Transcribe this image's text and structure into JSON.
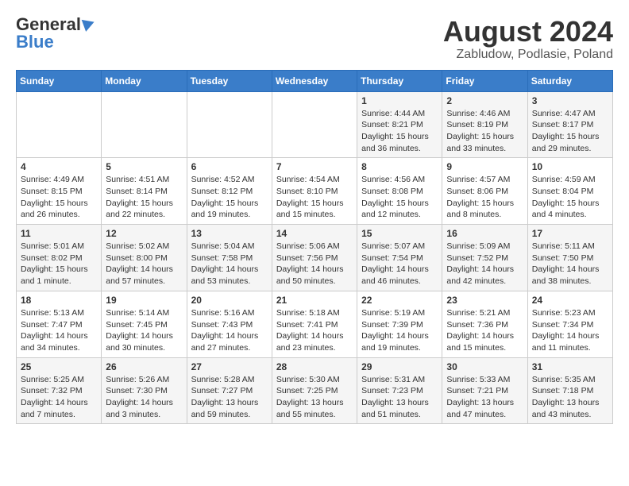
{
  "header": {
    "logo_top": "General",
    "logo_bottom": "Blue",
    "title": "August 2024",
    "subtitle": "Zabludow, Podlasie, Poland"
  },
  "calendar": {
    "days_of_week": [
      "Sunday",
      "Monday",
      "Tuesday",
      "Wednesday",
      "Thursday",
      "Friday",
      "Saturday"
    ],
    "weeks": [
      [
        {
          "day": "",
          "info": ""
        },
        {
          "day": "",
          "info": ""
        },
        {
          "day": "",
          "info": ""
        },
        {
          "day": "",
          "info": ""
        },
        {
          "day": "1",
          "info": "Sunrise: 4:44 AM\nSunset: 8:21 PM\nDaylight: 15 hours\nand 36 minutes."
        },
        {
          "day": "2",
          "info": "Sunrise: 4:46 AM\nSunset: 8:19 PM\nDaylight: 15 hours\nand 33 minutes."
        },
        {
          "day": "3",
          "info": "Sunrise: 4:47 AM\nSunset: 8:17 PM\nDaylight: 15 hours\nand 29 minutes."
        }
      ],
      [
        {
          "day": "4",
          "info": "Sunrise: 4:49 AM\nSunset: 8:15 PM\nDaylight: 15 hours\nand 26 minutes."
        },
        {
          "day": "5",
          "info": "Sunrise: 4:51 AM\nSunset: 8:14 PM\nDaylight: 15 hours\nand 22 minutes."
        },
        {
          "day": "6",
          "info": "Sunrise: 4:52 AM\nSunset: 8:12 PM\nDaylight: 15 hours\nand 19 minutes."
        },
        {
          "day": "7",
          "info": "Sunrise: 4:54 AM\nSunset: 8:10 PM\nDaylight: 15 hours\nand 15 minutes."
        },
        {
          "day": "8",
          "info": "Sunrise: 4:56 AM\nSunset: 8:08 PM\nDaylight: 15 hours\nand 12 minutes."
        },
        {
          "day": "9",
          "info": "Sunrise: 4:57 AM\nSunset: 8:06 PM\nDaylight: 15 hours\nand 8 minutes."
        },
        {
          "day": "10",
          "info": "Sunrise: 4:59 AM\nSunset: 8:04 PM\nDaylight: 15 hours\nand 4 minutes."
        }
      ],
      [
        {
          "day": "11",
          "info": "Sunrise: 5:01 AM\nSunset: 8:02 PM\nDaylight: 15 hours\nand 1 minute."
        },
        {
          "day": "12",
          "info": "Sunrise: 5:02 AM\nSunset: 8:00 PM\nDaylight: 14 hours\nand 57 minutes."
        },
        {
          "day": "13",
          "info": "Sunrise: 5:04 AM\nSunset: 7:58 PM\nDaylight: 14 hours\nand 53 minutes."
        },
        {
          "day": "14",
          "info": "Sunrise: 5:06 AM\nSunset: 7:56 PM\nDaylight: 14 hours\nand 50 minutes."
        },
        {
          "day": "15",
          "info": "Sunrise: 5:07 AM\nSunset: 7:54 PM\nDaylight: 14 hours\nand 46 minutes."
        },
        {
          "day": "16",
          "info": "Sunrise: 5:09 AM\nSunset: 7:52 PM\nDaylight: 14 hours\nand 42 minutes."
        },
        {
          "day": "17",
          "info": "Sunrise: 5:11 AM\nSunset: 7:50 PM\nDaylight: 14 hours\nand 38 minutes."
        }
      ],
      [
        {
          "day": "18",
          "info": "Sunrise: 5:13 AM\nSunset: 7:47 PM\nDaylight: 14 hours\nand 34 minutes."
        },
        {
          "day": "19",
          "info": "Sunrise: 5:14 AM\nSunset: 7:45 PM\nDaylight: 14 hours\nand 30 minutes."
        },
        {
          "day": "20",
          "info": "Sunrise: 5:16 AM\nSunset: 7:43 PM\nDaylight: 14 hours\nand 27 minutes."
        },
        {
          "day": "21",
          "info": "Sunrise: 5:18 AM\nSunset: 7:41 PM\nDaylight: 14 hours\nand 23 minutes."
        },
        {
          "day": "22",
          "info": "Sunrise: 5:19 AM\nSunset: 7:39 PM\nDaylight: 14 hours\nand 19 minutes."
        },
        {
          "day": "23",
          "info": "Sunrise: 5:21 AM\nSunset: 7:36 PM\nDaylight: 14 hours\nand 15 minutes."
        },
        {
          "day": "24",
          "info": "Sunrise: 5:23 AM\nSunset: 7:34 PM\nDaylight: 14 hours\nand 11 minutes."
        }
      ],
      [
        {
          "day": "25",
          "info": "Sunrise: 5:25 AM\nSunset: 7:32 PM\nDaylight: 14 hours\nand 7 minutes."
        },
        {
          "day": "26",
          "info": "Sunrise: 5:26 AM\nSunset: 7:30 PM\nDaylight: 14 hours\nand 3 minutes."
        },
        {
          "day": "27",
          "info": "Sunrise: 5:28 AM\nSunset: 7:27 PM\nDaylight: 13 hours\nand 59 minutes."
        },
        {
          "day": "28",
          "info": "Sunrise: 5:30 AM\nSunset: 7:25 PM\nDaylight: 13 hours\nand 55 minutes."
        },
        {
          "day": "29",
          "info": "Sunrise: 5:31 AM\nSunset: 7:23 PM\nDaylight: 13 hours\nand 51 minutes."
        },
        {
          "day": "30",
          "info": "Sunrise: 5:33 AM\nSunset: 7:21 PM\nDaylight: 13 hours\nand 47 minutes."
        },
        {
          "day": "31",
          "info": "Sunrise: 5:35 AM\nSunset: 7:18 PM\nDaylight: 13 hours\nand 43 minutes."
        }
      ]
    ]
  }
}
